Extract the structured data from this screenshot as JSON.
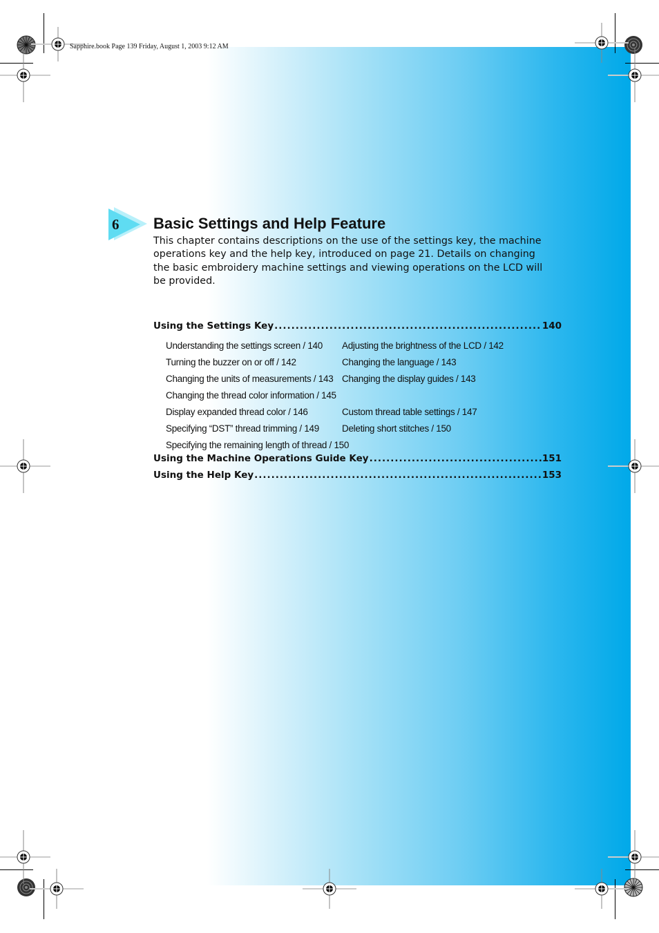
{
  "slug_line": "Sapphire.book  Page 139  Friday, August 1, 2003  9:12 AM",
  "colors": {
    "band_start": "#ffffff",
    "band_end": "#00a9e9",
    "chapter_arrow": "#5fdcf2"
  },
  "chapter": {
    "number": "6",
    "title": "Basic Settings and Help Feature",
    "intro": "This chapter contains descriptions on the use of the settings key, the machine operations key and the help key, introduced on page 21. Details on changing the basic embroidery machine settings and viewing operations on the LCD will be provided."
  },
  "toc": {
    "sections": [
      {
        "label": "Using the Settings Key",
        "page": "140",
        "subrows": [
          [
            "Understanding the settings screen / 140",
            "Adjusting the brightness of the LCD / 142"
          ],
          [
            "Turning the buzzer on or off / 142",
            "Changing the language / 143"
          ],
          [
            "Changing the units of measurements / 143",
            "Changing the display guides / 143"
          ],
          [
            "Changing the thread color information / 145",
            ""
          ],
          [
            "Display expanded thread color / 146",
            "Custom thread table settings / 147"
          ],
          [
            "Specifying “DST” thread trimming / 149",
            "Deleting short stitches / 150"
          ],
          [
            "Specifying the remaining length of thread / 150",
            ""
          ]
        ]
      },
      {
        "label": "Using the Machine Operations Guide Key",
        "page": "151",
        "subrows": []
      },
      {
        "label": "Using the Help Key",
        "page": "153",
        "subrows": []
      }
    ]
  }
}
